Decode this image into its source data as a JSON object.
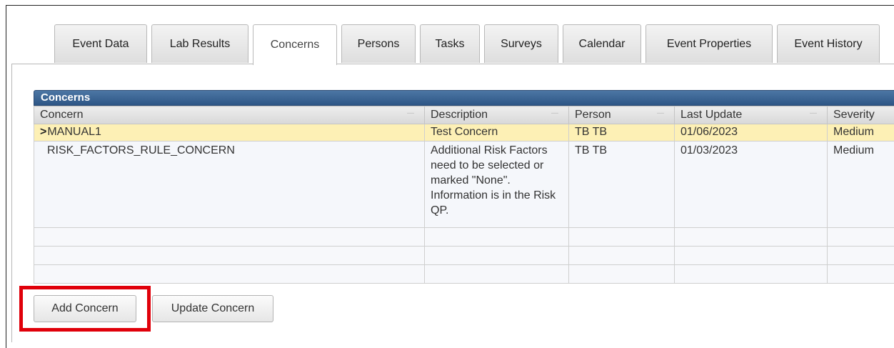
{
  "tabs": [
    {
      "label": "Event Data"
    },
    {
      "label": "Lab Results"
    },
    {
      "label": "Concerns",
      "active": true
    },
    {
      "label": "Persons"
    },
    {
      "label": "Tasks"
    },
    {
      "label": "Surveys"
    },
    {
      "label": "Calendar"
    },
    {
      "label": "Event Properties"
    },
    {
      "label": "Event History"
    }
  ],
  "grid": {
    "title": "Concerns",
    "columns": [
      "Concern",
      "Description",
      "Person",
      "Last Update",
      "Severity"
    ],
    "rows": [
      {
        "concern": "MANUAL1",
        "description": "Test Concern",
        "person": "TB TB",
        "last_update": "01/06/2023",
        "severity": "Medium",
        "selected": true
      },
      {
        "concern": "RISK_FACTORS_RULE_CONCERN",
        "description": "Additional Risk Factors need to be selected or marked \"None\". Information is in the Risk QP.",
        "person": "TB TB",
        "last_update": "01/03/2023",
        "severity": "Medium",
        "selected": false
      }
    ]
  },
  "buttons": {
    "add": "Add Concern",
    "update": "Update Concern"
  },
  "colors": {
    "grid_header": "#2e5686",
    "selected_row": "#fdf0b5",
    "highlight_box": "#e0000a"
  }
}
